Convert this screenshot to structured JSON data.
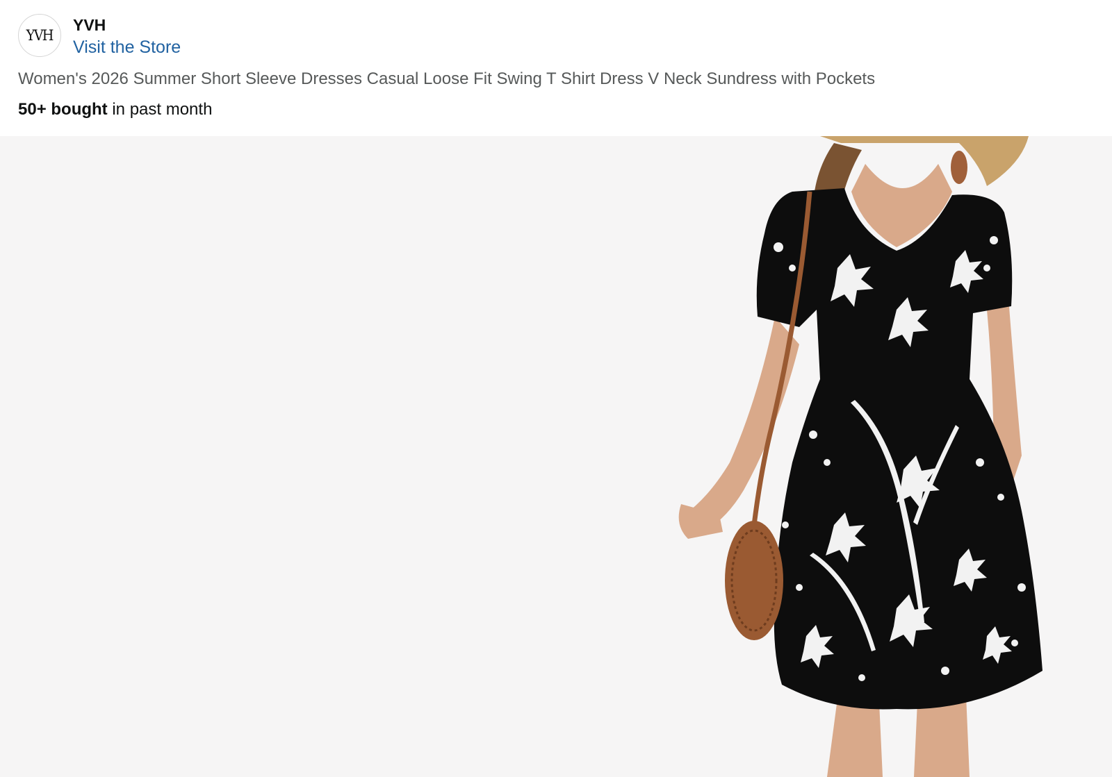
{
  "store": {
    "logo_text": "YVH",
    "name": "YVH",
    "visit_label": "Visit the Store"
  },
  "product": {
    "title": "Women's 2026 Summer Short Sleeve Dresses Casual Loose Fit Swing T Shirt Dress V Neck Sundress with Pockets",
    "bought_count": "50+ bought",
    "bought_suffix": " in past month",
    "image": {
      "icon": "product-photo-dress",
      "background_color": "#f6f5f5",
      "dress_color": "#0d0d0d",
      "print_color": "#f2f2f2",
      "skin_color": "#d9a98a",
      "bag_color": "#9a5a32",
      "hat_color": "#c9a36b"
    }
  }
}
